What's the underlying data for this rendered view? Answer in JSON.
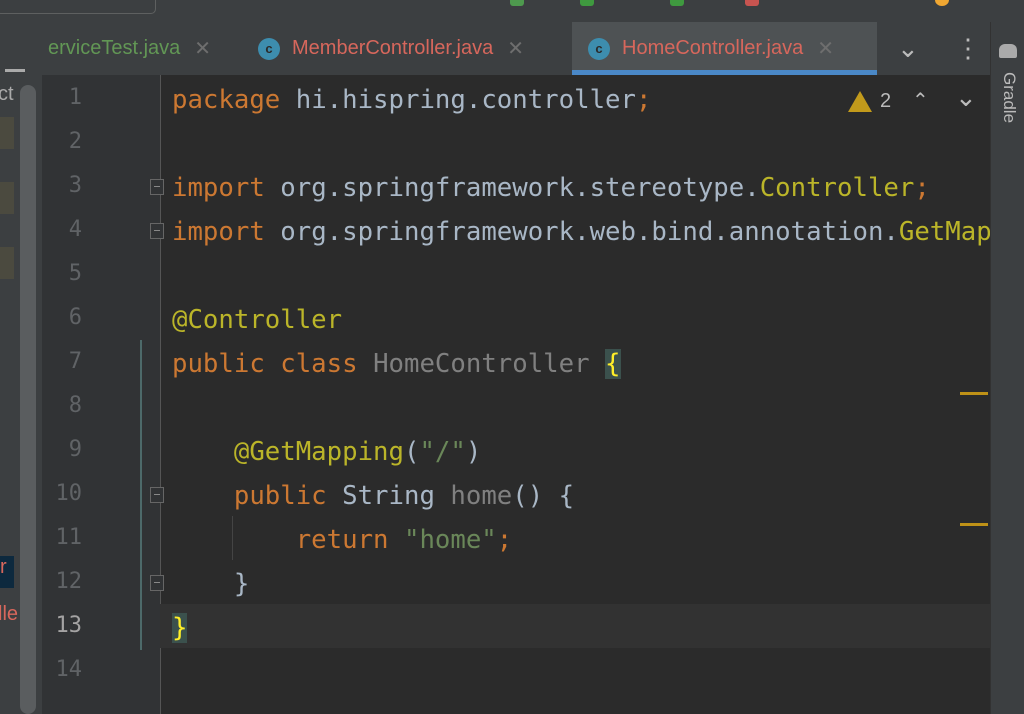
{
  "tabs": [
    {
      "label": "erviceTest.java",
      "color": "#629755",
      "icon": false
    },
    {
      "label": "MemberController.java",
      "color": "#d7675c",
      "icon": true
    },
    {
      "label": "HomeController.java",
      "color": "#d7675c",
      "icon": true,
      "active": true
    }
  ],
  "tab_close": "✕",
  "tab_more": "⌄",
  "tab_menu": "⋮",
  "class_icon": "c",
  "right_bar": {
    "label": "Gradle"
  },
  "left_panel": {
    "snippet": "ct",
    "item1": "r",
    "item2": "lle"
  },
  "warnings": {
    "count": "2",
    "up": "⌃",
    "down": "⌄"
  },
  "current_line": 13,
  "code": [
    [
      [
        "kw",
        "package "
      ],
      [
        "def",
        "hi.hispring.controller"
      ],
      [
        "kw",
        ";"
      ]
    ],
    [],
    [
      [
        "kw",
        "import "
      ],
      [
        "def",
        "org.springframework.stereotype."
      ],
      [
        "ann",
        "Controller"
      ],
      [
        "kw",
        ";"
      ]
    ],
    [
      [
        "kw",
        "import "
      ],
      [
        "def",
        "org.springframework.web.bind.annotation."
      ],
      [
        "ann",
        "GetMapping"
      ],
      [
        "kw",
        ";"
      ]
    ],
    [],
    [
      [
        "ann",
        "@Controller"
      ]
    ],
    [
      [
        "kw",
        "public class "
      ],
      [
        "dim",
        "HomeController "
      ],
      [
        "brace",
        "{"
      ]
    ],
    [],
    [
      [
        "ann",
        "    @GetMapping"
      ],
      [
        "def",
        "("
      ],
      [
        "str",
        "\"/\""
      ],
      [
        "def",
        ")"
      ]
    ],
    [
      [
        "kw",
        "    public "
      ],
      [
        "def",
        "String "
      ],
      [
        "dim",
        "home"
      ],
      [
        "def",
        "() {"
      ]
    ],
    [
      [
        "kw",
        "        return "
      ],
      [
        "str",
        "\"home\""
      ],
      [
        "kw",
        ";"
      ]
    ],
    [
      [
        "def",
        "    }"
      ]
    ],
    [
      [
        "brace",
        "}"
      ]
    ],
    []
  ]
}
